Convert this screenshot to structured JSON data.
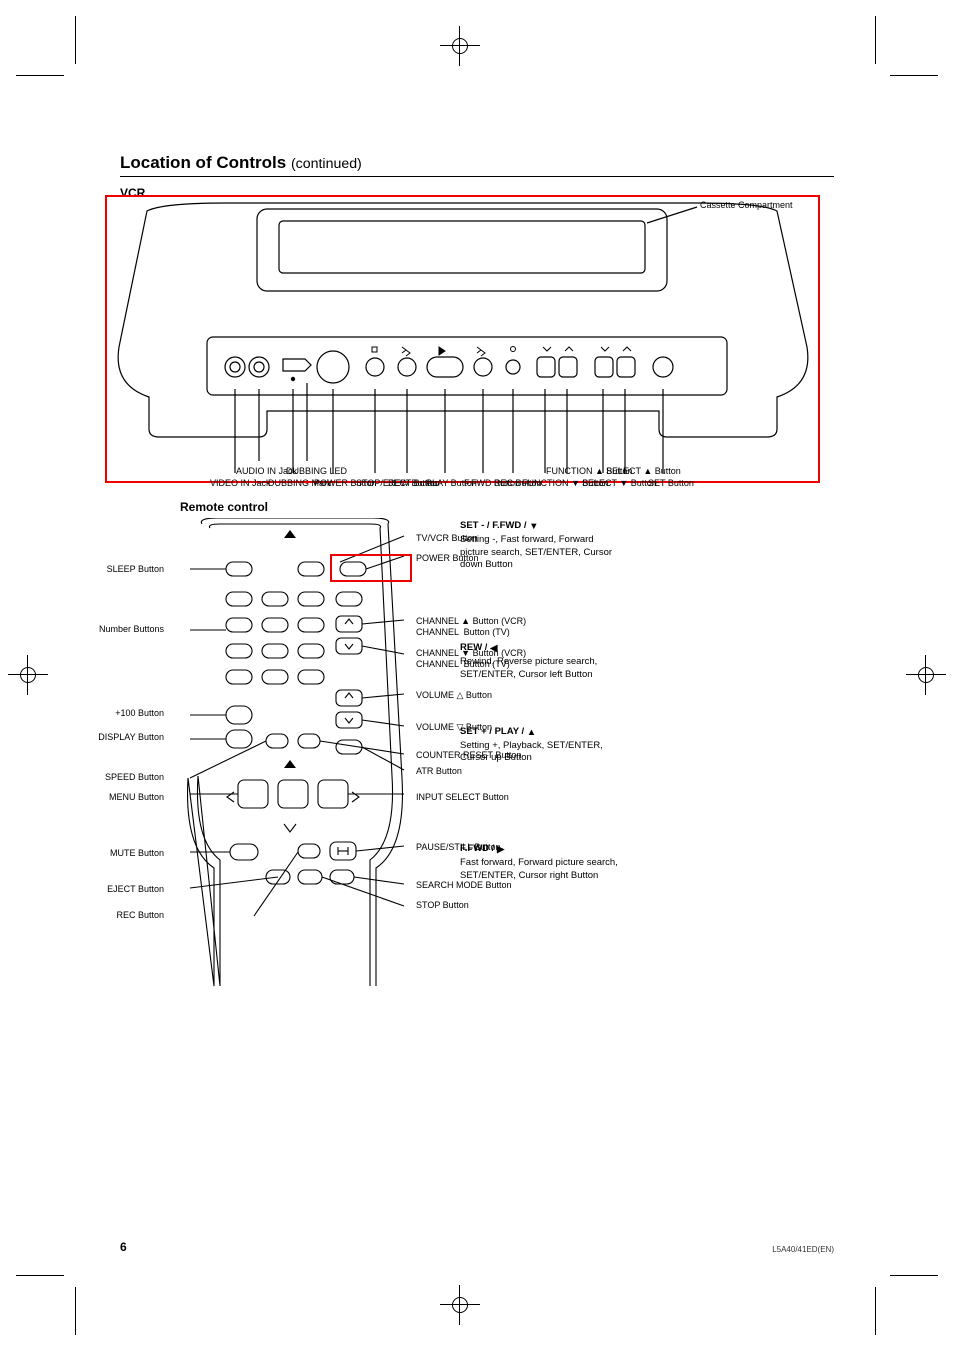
{
  "page_number": "6",
  "footer_id": "L5A40/41ED(EN)",
  "title_main": "Location of Controls",
  "title_cont": "(continued)",
  "section_vcr": "VCR",
  "section_remote": "Remote control",
  "vcr": {
    "slot": "Cassette Compartment",
    "vin": "VIDEO IN Jack",
    "ain": "AUDIO IN Jack",
    "dubbing": "DUBBING Mark",
    "dubbing_led": "DUBBING LED",
    "power": "POWER Button",
    "stop_eject": "STOP/EJECT Button",
    "rew": "REW Button",
    "play": "PLAY Button",
    "ff": "F.FWD Button",
    "rec": "REC Button",
    "fn_dn": "FUNCTION ▼ Button",
    "fn_up": "FUNCTION ▲ Button",
    "sel_dn": "SELECT ▼ Button",
    "sel_up": "SELECT ▲ Button",
    "set": "SET Button"
  },
  "remote": {
    "left": {
      "sleep": "SLEEP Button",
      "numbers": "Number Buttons",
      "p100": "+100 Button",
      "display": "DISPLAY Button",
      "speed": "SPEED Button",
      "menu": "MENU Button",
      "mute": "MUTE Button",
      "eject": "EJECT Button",
      "rec": "REC Button"
    },
    "right": {
      "tvvcr": "TV/VCR Button",
      "power": "POWER Button",
      "chup": "CHANNEL ▲ Button (VCR)\nCHANNEL  Button (TV)",
      "chdn": "CHANNEL ▼ Button (VCR)\nCHANNEL  Button (TV)",
      "volup": "VOLUME △ Button",
      "voldn": "VOLUME ▽ Button",
      "counter": "COUNTER RESET Button",
      "atr": "ATR Button",
      "input": "INPUT SELECT Button",
      "pause": "PAUSE/STILL Button",
      "search": "SEARCH MODE Button",
      "stop": "STOP Button"
    }
  },
  "multi": [
    {
      "sym": "▼",
      "head": "SET - / F.FWD /",
      "line1": "Setting -, Fast forward, Forward",
      "line2": "picture search, SET/ENTER, Cursor",
      "line3": "down Button"
    },
    {
      "sym": "◀",
      "head": "REW /",
      "line1": "Rewind, Reverse picture search,",
      "line2": "SET/ENTER, Cursor left Button",
      "line3": ""
    },
    {
      "sym": "▲",
      "head": "SET + / PLAY /",
      "line1": "Setting +, Playback, SET/ENTER,",
      "line2": "Cursor up Button",
      "line3": ""
    },
    {
      "sym": "▶",
      "head": "F.FWD /",
      "line1": "Fast forward, Forward picture search,",
      "line2": "SET/ENTER, Cursor right Button",
      "line3": ""
    }
  ]
}
